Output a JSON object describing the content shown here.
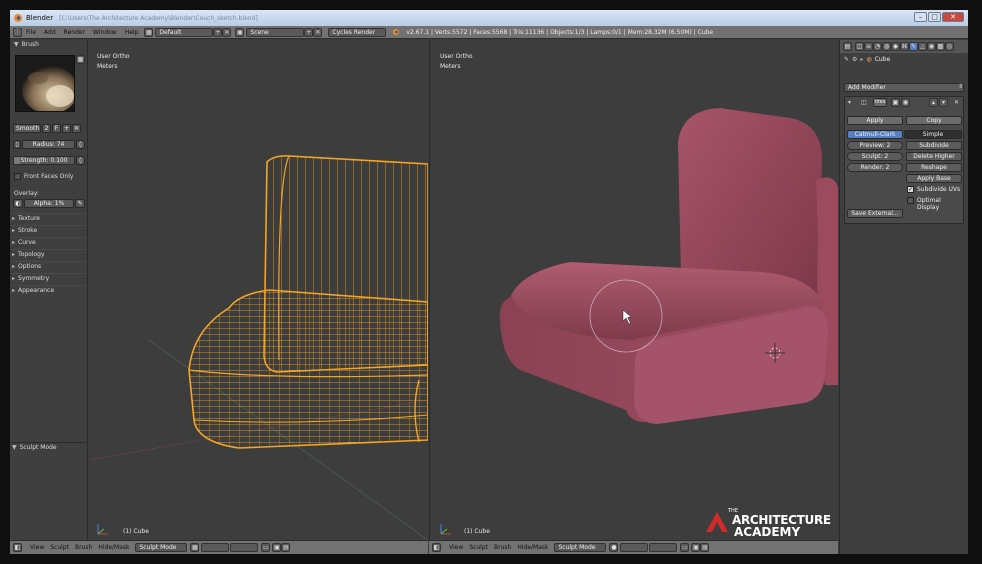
{
  "window": {
    "title": "Blender",
    "blurred_path": "[C:\\Users\\The Architecture Academy\\Blender\\Couch_sketch.blend]",
    "min": "–",
    "max": "□",
    "close": "✕"
  },
  "topbar": {
    "menus": [
      "File",
      "Add",
      "Render",
      "Window",
      "Help"
    ],
    "layout": "Default",
    "scene": "Scene",
    "engine": "Cycles Render",
    "info": "v2.67.1 | Verts:5572 | Faces:5568 | Tris:11136 | Objects:1/3 | Lamps:0/1 | Mem:28.32M (6.50M) | Cube"
  },
  "left_panel": {
    "brush_header": "Brush",
    "brush_name": "Smooth",
    "brush_users": "2",
    "brush_fake": "F",
    "radius": "Radius: 74",
    "strength": "Strength: 0.100",
    "front_faces": "Front Faces Only",
    "overlay_label": "Overlay:",
    "alpha": "Alpha: 1%",
    "sections": [
      "Texture",
      "Stroke",
      "Curve",
      "Topology",
      "Options",
      "Symmetry",
      "Appearance"
    ],
    "sculpt_mode_header": "Sculpt Mode"
  },
  "viewport_left": {
    "view": "User Ortho",
    "units": "Meters",
    "object": "(1) Cube"
  },
  "viewport_right": {
    "view": "User Ortho",
    "units": "Meters",
    "object": "(1) Cube"
  },
  "bottom_left": {
    "menus": [
      "View",
      "Sculpt",
      "Brush",
      "Hide/Mask"
    ],
    "mode": "Sculpt Mode"
  },
  "bottom_right": {
    "menus": [
      "View",
      "Sculpt",
      "Brush",
      "Hide/Mask"
    ],
    "mode": "Sculpt Mode"
  },
  "properties": {
    "object_name": "Cube",
    "add_modifier": "Add Modifier",
    "modifier_name": "tires",
    "apply": "Apply",
    "copy": "Copy",
    "catmull": "Catmull-Clark",
    "simple": "Simple",
    "preview": "Preview: 2",
    "sculpt": "Sculpt: 2",
    "render": "Render: 2",
    "subdivide": "Subdivide",
    "delete_higher": "Delete Higher",
    "reshape": "Reshape",
    "apply_base": "Apply Base",
    "subdivide_uvs": "Subdivide UVs",
    "optimal_display": "Optimal Display",
    "save_external": "Save External..."
  },
  "watermark": {
    "line1": "ARCHITECTURE",
    "line2": "ACADEMY",
    "prefix": "THE"
  },
  "colors": {
    "wire": "#f5a623",
    "sofa": "#9a4a5c",
    "active_blue": "#5680c2"
  }
}
